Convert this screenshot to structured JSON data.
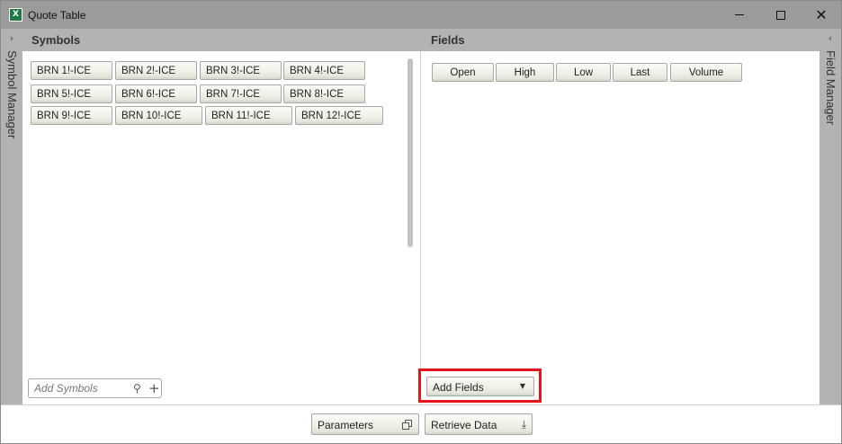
{
  "window": {
    "title": "Quote Table",
    "app_icon": "X"
  },
  "left_strip": {
    "label": "Symbol Manager",
    "chevron": "›"
  },
  "right_strip": {
    "label": "Field Manager",
    "chevron": "‹"
  },
  "symbols": {
    "header": "Symbols",
    "items": [
      "BRN 1!-ICE",
      "BRN 2!-ICE",
      "BRN 3!-ICE",
      "BRN 4!-ICE",
      "BRN 5!-ICE",
      "BRN 6!-ICE",
      "BRN 7!-ICE",
      "BRN 8!-ICE",
      "BRN 9!-ICE",
      "BRN 10!-ICE",
      "BRN 11!-ICE",
      "BRN 12!-ICE"
    ],
    "search_placeholder": "Add Symbols"
  },
  "fields": {
    "header": "Fields",
    "items": [
      "Open",
      "High",
      "Low",
      "Last",
      "Volume"
    ],
    "add_label": "Add Fields"
  },
  "footer": {
    "parameters_label": "Parameters",
    "retrieve_label": "Retrieve Data"
  },
  "colors": {
    "title_bar": "#9b9b9b",
    "panel_header": "#b3b3b3",
    "highlight": "#e8141c",
    "app_icon": "#1f7a43"
  }
}
